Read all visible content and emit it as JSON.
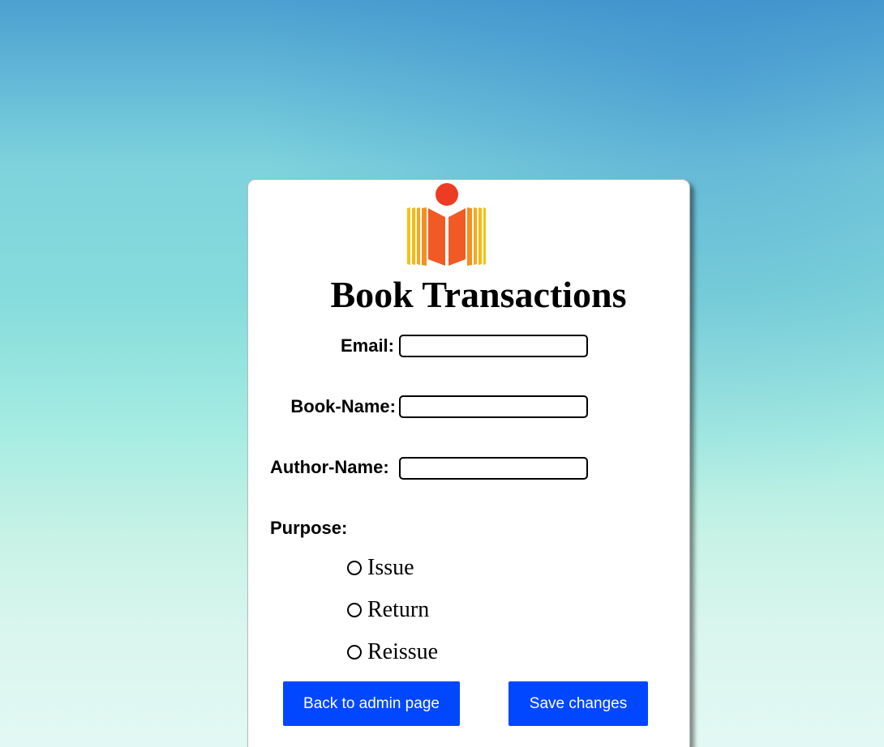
{
  "header": {
    "title": "Book Transactions"
  },
  "form": {
    "email_label": "Email:",
    "email_value": "",
    "book_name_label": "Book-Name:",
    "book_name_value": "",
    "author_name_label": "Author-Name:",
    "author_name_value": "",
    "purpose_label": "Purpose:",
    "purpose_options": [
      "Issue",
      "Return",
      "Reissue"
    ],
    "purpose_selected": ""
  },
  "buttons": {
    "back_label": "Back to admin page",
    "save_label": "Save changes"
  },
  "colors": {
    "button_bg": "#0047ff",
    "logo_dot": "#ee3b24",
    "logo_center": "#f15a24",
    "logo_outer": "#f7a81b"
  },
  "icons": {
    "logo": "open-book-logo-icon"
  }
}
